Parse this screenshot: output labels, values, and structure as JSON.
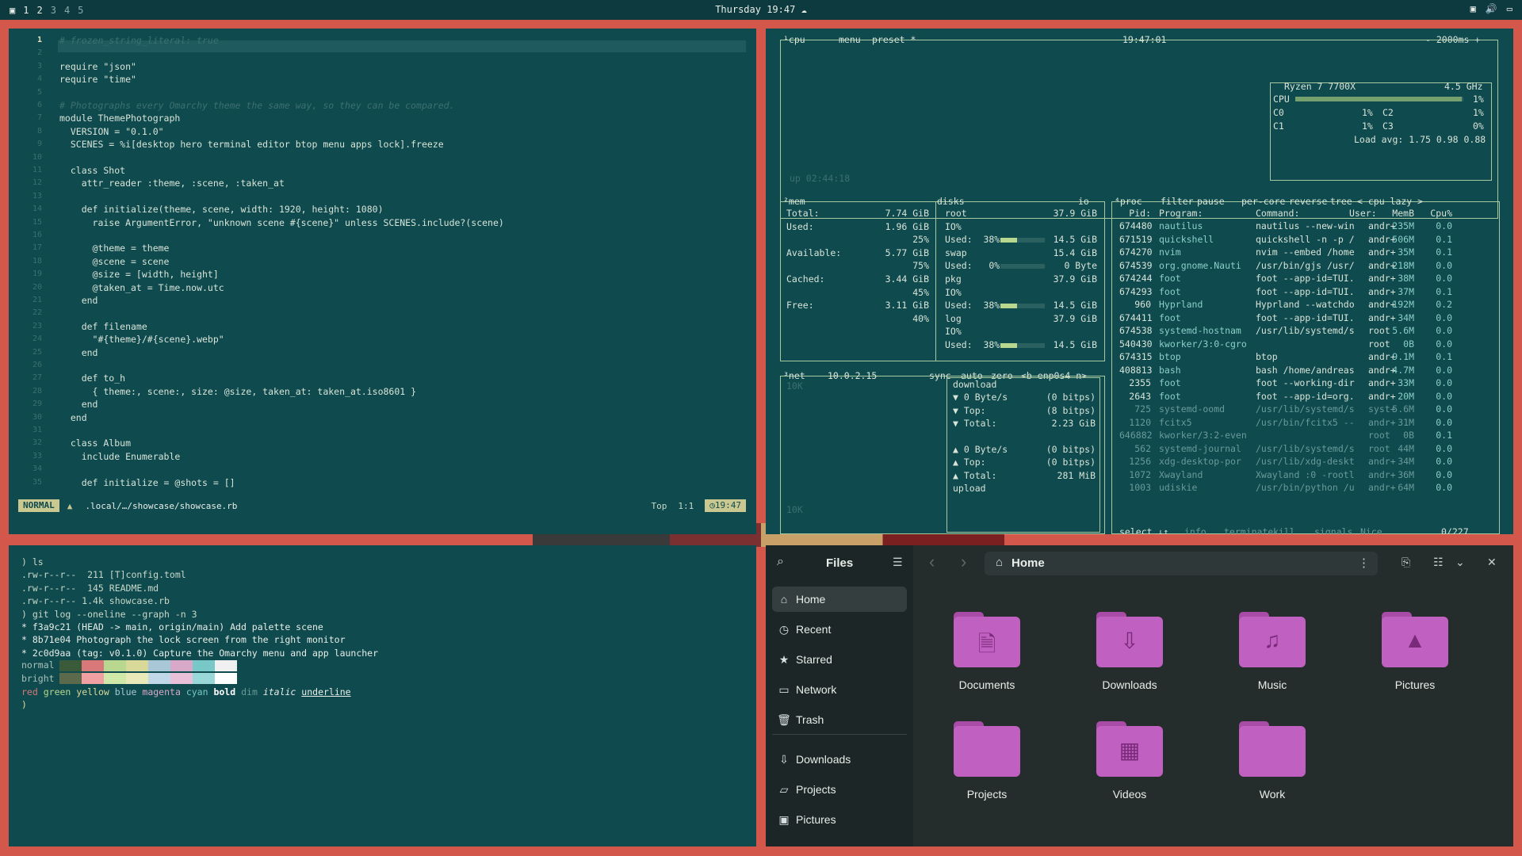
{
  "topbar": {
    "workspaces": [
      "1",
      "2",
      "3",
      "4",
      "5"
    ],
    "clock": "Thursday 19:47"
  },
  "nvim": {
    "lines": [
      {
        "n": "1",
        "t": "# frozen_string_literal: true"
      },
      {
        "n": "2",
        "t": ""
      },
      {
        "n": "3",
        "t": "require \"json\""
      },
      {
        "n": "4",
        "t": "require \"time\""
      },
      {
        "n": "5",
        "t": ""
      },
      {
        "n": "6",
        "t": "# Photographs every Omarchy theme the same way, so they can be compared."
      },
      {
        "n": "7",
        "t": "module ThemePhotograph"
      },
      {
        "n": "8",
        "t": "  VERSION = \"0.1.0\""
      },
      {
        "n": "9",
        "t": "  SCENES = %i[desktop hero terminal editor btop menu apps lock].freeze"
      },
      {
        "n": "10",
        "t": ""
      },
      {
        "n": "11",
        "t": "  class Shot"
      },
      {
        "n": "12",
        "t": "    attr_reader :theme, :scene, :taken_at"
      },
      {
        "n": "13",
        "t": ""
      },
      {
        "n": "14",
        "t": "    def initialize(theme, scene, width: 1920, height: 1080)"
      },
      {
        "n": "15",
        "t": "      raise ArgumentError, \"unknown scene #{scene}\" unless SCENES.include?(scene)"
      },
      {
        "n": "16",
        "t": ""
      },
      {
        "n": "17",
        "t": "      @theme = theme"
      },
      {
        "n": "18",
        "t": "      @scene = scene"
      },
      {
        "n": "19",
        "t": "      @size = [width, height]"
      },
      {
        "n": "20",
        "t": "      @taken_at = Time.now.utc"
      },
      {
        "n": "21",
        "t": "    end"
      },
      {
        "n": "22",
        "t": ""
      },
      {
        "n": "23",
        "t": "    def filename"
      },
      {
        "n": "24",
        "t": "      \"#{theme}/#{scene}.webp\""
      },
      {
        "n": "25",
        "t": "    end"
      },
      {
        "n": "26",
        "t": ""
      },
      {
        "n": "27",
        "t": "    def to_h"
      },
      {
        "n": "28",
        "t": "      { theme:, scene:, size: @size, taken_at: taken_at.iso8601 }"
      },
      {
        "n": "29",
        "t": "    end"
      },
      {
        "n": "30",
        "t": "  end"
      },
      {
        "n": "31",
        "t": ""
      },
      {
        "n": "32",
        "t": "  class Album"
      },
      {
        "n": "33",
        "t": "    include Enumerable"
      },
      {
        "n": "34",
        "t": ""
      },
      {
        "n": "35",
        "t": "    def initialize = @shots = []"
      }
    ],
    "mode": "NORMAL",
    "file": ".local/…/showcase/showcase.rb",
    "pos": "Top",
    "cursor": "1:1",
    "time": "19:47"
  },
  "terminal": {
    "lines": [
      ") ls",
      ".rw-r--r--  211 [T]config.toml",
      ".rw-r--r--  145 README.md",
      ".rw-r--r-- 1.4k showcase.rb",
      ") git log --oneline --graph -n 3",
      "* f3a9c21 (HEAD -> main, origin/main) Add palette scene",
      "* 8b71e04 Photograph the lock screen from the right monitor",
      "* 2c0d9aa (tag: v0.1.0) Capture the Omarchy menu and app launcher"
    ],
    "palette_labels": [
      "normal",
      "bright"
    ],
    "palette_normal": [
      "#3a5a3a",
      "#d87878",
      "#b8d890",
      "#d8d898",
      "#a8c8d8",
      "#d8a8c8",
      "#78c8c8",
      "#f0f0f0"
    ],
    "palette_bright": [
      "#5a6a4a",
      "#f0a0a0",
      "#d0e8a8",
      "#e8e8b8",
      "#c0d8e8",
      "#e8c0d8",
      "#98d8d8",
      "#ffffff"
    ],
    "styles_line": [
      "red",
      "green",
      "yellow",
      "blue",
      "magenta",
      "cyan",
      "bold",
      "dim",
      "italic",
      "underline"
    ],
    "prompt": ")"
  },
  "btop": {
    "cpu_header": [
      "¹cpu",
      "menu",
      "preset *",
      "19:47:01",
      "- 2000ms +"
    ],
    "uptime": "up 02:44:18",
    "cpu_model": "Ryzen 7 7700X",
    "cpu_freq": "4.5 GHz",
    "cpu_rows": [
      {
        "l": "CPU",
        "v": "1%"
      },
      {
        "l": "C0",
        "v": "1%",
        "l2": "C2",
        "v2": "1%"
      },
      {
        "l": "C1",
        "v": "1%",
        "l2": "C3",
        "v2": "0%"
      }
    ],
    "load_avg": "Load avg: 1.75 0.98 0.88",
    "mem_header": [
      "²mem",
      "disks",
      "io"
    ],
    "mem": [
      {
        "l": "Total:",
        "v": "7.74 GiB"
      },
      {
        "l": "Used:",
        "v": "1.96 GiB"
      },
      {
        "l": "",
        "v": "25%"
      },
      {
        "l": "Available:",
        "v": "5.77 GiB"
      },
      {
        "l": "",
        "v": "75%"
      },
      {
        "l": "Cached:",
        "v": "3.44 GiB"
      },
      {
        "l": "",
        "v": "45%"
      },
      {
        "l": "Free:",
        "v": "3.11 GiB"
      },
      {
        "l": "",
        "v": "40%"
      }
    ],
    "disks": [
      {
        "l": "root",
        "v": "37.9 GiB"
      },
      {
        "l": "IO%",
        "v": ""
      },
      {
        "l": "Used:  38%",
        "v": "14.5 GiB",
        "bar": 0.38
      },
      {
        "l": "swap",
        "v": "15.4 GiB"
      },
      {
        "l": "Used:   0%",
        "v": "0 Byte",
        "bar": 0.0
      },
      {
        "l": "pkg",
        "v": "37.9 GiB"
      },
      {
        "l": "IO%",
        "v": ""
      },
      {
        "l": "Used:  38%",
        "v": "14.5 GiB",
        "bar": 0.38
      },
      {
        "l": "log",
        "v": "37.9 GiB"
      },
      {
        "l": "IO%",
        "v": ""
      },
      {
        "l": "Used:  38%",
        "v": "14.5 GiB",
        "bar": 0.38
      }
    ],
    "net_header": [
      "³net",
      "10.0.2.15",
      "sync",
      "auto",
      "zero",
      "<b enp0s4 n>"
    ],
    "net": [
      {
        "l": "download",
        "v": ""
      },
      {
        "l": "▼ 0 Byte/s",
        "v": "(0 bitps)"
      },
      {
        "l": "▼ Top:",
        "v": "(8 bitps)"
      },
      {
        "l": "▼ Total:",
        "v": "2.23 GiB"
      },
      {
        "l": "",
        "v": ""
      },
      {
        "l": "▲ 0 Byte/s",
        "v": "(0 bitps)"
      },
      {
        "l": "▲ Top:",
        "v": "(0 bitps)"
      },
      {
        "l": "▲ Total:",
        "v": "281 MiB"
      },
      {
        "l": "upload",
        "v": ""
      }
    ],
    "net_scale_top": "10K",
    "net_scale_bot": "10K",
    "proc_header": [
      "⁴proc",
      "filter",
      "pause",
      "per-core",
      "reverse",
      "tree",
      "< cpu lazy >"
    ],
    "proc_cols": [
      "Pid:",
      "Program:",
      "Command:",
      "User:",
      "MemB",
      "Cpu%"
    ],
    "procs": [
      [
        "674480",
        "nautilus",
        "nautilus --new-win",
        "andr+",
        "235M",
        "0.0"
      ],
      [
        "671519",
        "quickshell",
        "quickshell -n -p /",
        "andr+",
        "506M",
        "0.1"
      ],
      [
        "674270",
        "nvim",
        "nvim --embed /home",
        "andr+",
        "35M",
        "0.1"
      ],
      [
        "674539",
        "org.gnome.Nauti",
        "/usr/bin/gjs /usr/",
        "andr+",
        "218M",
        "0.0"
      ],
      [
        "674244",
        "foot",
        "foot --app-id=TUI.",
        "andr+",
        "38M",
        "0.0"
      ],
      [
        "674293",
        "foot",
        "foot --app-id=TUI.",
        "andr+",
        "37M",
        "0.1"
      ],
      [
        "960",
        "Hyprland",
        "Hyprland --watchdo",
        "andr+",
        "192M",
        "0.2"
      ],
      [
        "674411",
        "foot",
        "foot --app-id=TUI.",
        "andr+",
        "34M",
        "0.0"
      ],
      [
        "674538",
        "systemd-hostnam",
        "/usr/lib/systemd/s",
        "root",
        "5.6M",
        "0.0"
      ],
      [
        "540430",
        "kworker/3:0-cgro",
        "",
        "root",
        "0B",
        "0.0"
      ],
      [
        "674315",
        "btop",
        "btop",
        "andr+",
        "9.1M",
        "0.1"
      ],
      [
        "408813",
        "bash",
        "bash /home/andreas",
        "andr+",
        "4.7M",
        "0.0"
      ],
      [
        "2355",
        "foot",
        "foot --working-dir",
        "andr+",
        "33M",
        "0.0"
      ],
      [
        "2643",
        "foot",
        "foot --app-id=org.",
        "andr+",
        "20M",
        "0.0"
      ],
      [
        "725",
        "systemd-oomd",
        "/usr/lib/systemd/s",
        "syst+",
        "5.6M",
        "0.0"
      ],
      [
        "1120",
        "fcitx5",
        "/usr/bin/fcitx5 --",
        "andr+",
        "31M",
        "0.0"
      ],
      [
        "646882",
        "kworker/3:2-even",
        "",
        "root",
        "0B",
        "0.1"
      ],
      [
        "562",
        "systemd-journal",
        "/usr/lib/systemd/s",
        "root",
        "44M",
        "0.0"
      ],
      [
        "1256",
        "xdg-desktop-por",
        "/usr/lib/xdg-deskt",
        "andr+",
        "34M",
        "0.0"
      ],
      [
        "1072",
        "Xwayland",
        "Xwayland :0 -rootl",
        "andr+",
        "36M",
        "0.0"
      ],
      [
        "1003",
        "udiskie",
        "/usr/bin/python /u",
        "andr+",
        "64M",
        "0.0"
      ]
    ],
    "proc_footer": [
      "select ↓↑",
      "info",
      "terminate",
      "kill",
      "signals",
      "Nice",
      "0/227"
    ]
  },
  "files": {
    "title": "Files",
    "location": "Home",
    "sidebar": [
      {
        "label": "Home",
        "icon": "⌂"
      },
      {
        "label": "Recent",
        "icon": "◷"
      },
      {
        "label": "Starred",
        "icon": "★"
      },
      {
        "label": "Network",
        "icon": "▭"
      },
      {
        "label": "Trash",
        "icon": "🗑"
      },
      {
        "label": "Downloads",
        "icon": "⇩"
      },
      {
        "label": "Projects",
        "icon": "▱"
      },
      {
        "label": "Pictures",
        "icon": "▣"
      }
    ],
    "folders": [
      {
        "label": "Documents",
        "glyph": "🗎"
      },
      {
        "label": "Downloads",
        "glyph": "⇩"
      },
      {
        "label": "Music",
        "glyph": "♫"
      },
      {
        "label": "Pictures",
        "glyph": "▲"
      },
      {
        "label": "Projects",
        "glyph": ""
      },
      {
        "label": "Videos",
        "glyph": "▦"
      },
      {
        "label": "Work",
        "glyph": ""
      }
    ]
  }
}
